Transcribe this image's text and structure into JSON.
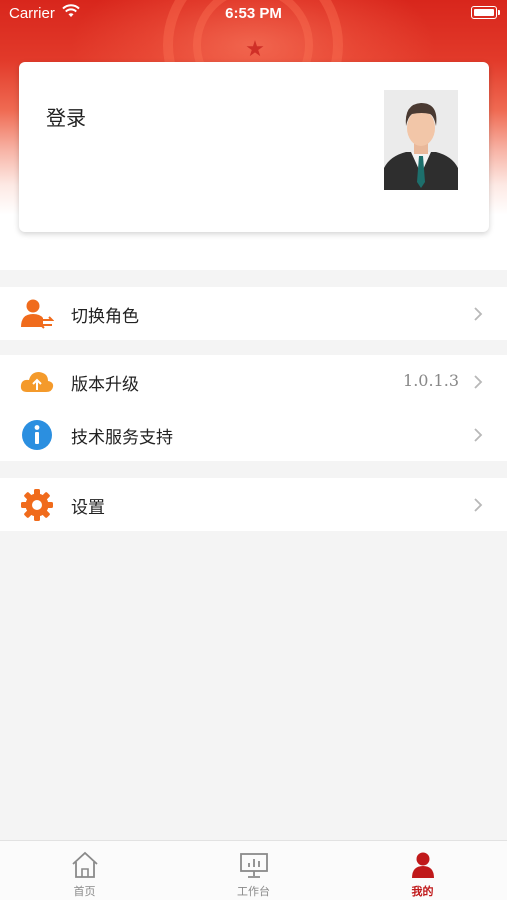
{
  "status_bar": {
    "carrier": "Carrier",
    "time": "6:53 PM"
  },
  "profile_card": {
    "login_label": "登录"
  },
  "menu": {
    "switch_role": {
      "label": "切换角色",
      "icon": "switch-role-icon"
    },
    "version_upgrade": {
      "label": "版本升级",
      "value": "1.0.1.3",
      "icon": "cloud-icon"
    },
    "tech_support": {
      "label": "技术服务支持",
      "icon": "info-icon"
    },
    "settings": {
      "label": "设置",
      "icon": "gear-icon"
    }
  },
  "tabbar": {
    "tabs": [
      {
        "label": "首页",
        "icon": "home-icon",
        "active": false
      },
      {
        "label": "工作台",
        "icon": "workbench-icon",
        "active": false
      },
      {
        "label": "我的",
        "icon": "profile-icon",
        "active": true
      }
    ]
  },
  "colors": {
    "brand_red": "#d8261c",
    "active_tab": "#c0191a",
    "icon_orange": "#f06b1c",
    "info_blue": "#2b8fe0"
  }
}
